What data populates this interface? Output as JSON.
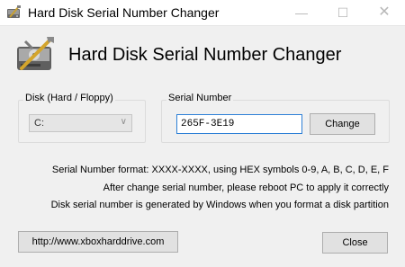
{
  "window": {
    "title": "Hard Disk Serial Number Changer"
  },
  "titlebar_controls": {
    "minimize": "—",
    "maximize": "☐",
    "close": "✕"
  },
  "header": {
    "title": "Hard Disk Serial Number Changer",
    "icon": "hard-disk-wrench-icon"
  },
  "disk_group": {
    "label": "Disk (Hard / Floppy)",
    "selected": "C:"
  },
  "serial_group": {
    "label": "Serial Number",
    "value": "265F-3E19",
    "change_label": "Change"
  },
  "info_lines": [
    "Serial Number format: XXXX-XXXX, using HEX symbols 0-9, A, B, C, D, E, F",
    "After change serial number, please reboot PC to apply it correctly",
    "Disk serial number is generated by Windows when you format a disk partition"
  ],
  "footer": {
    "url": "http://www.xboxharddrive.com",
    "close_label": "Close"
  },
  "colors": {
    "accent_border": "#2e80d6",
    "button_bg": "#e1e1e1",
    "window_bg": "#f0f0f0"
  }
}
